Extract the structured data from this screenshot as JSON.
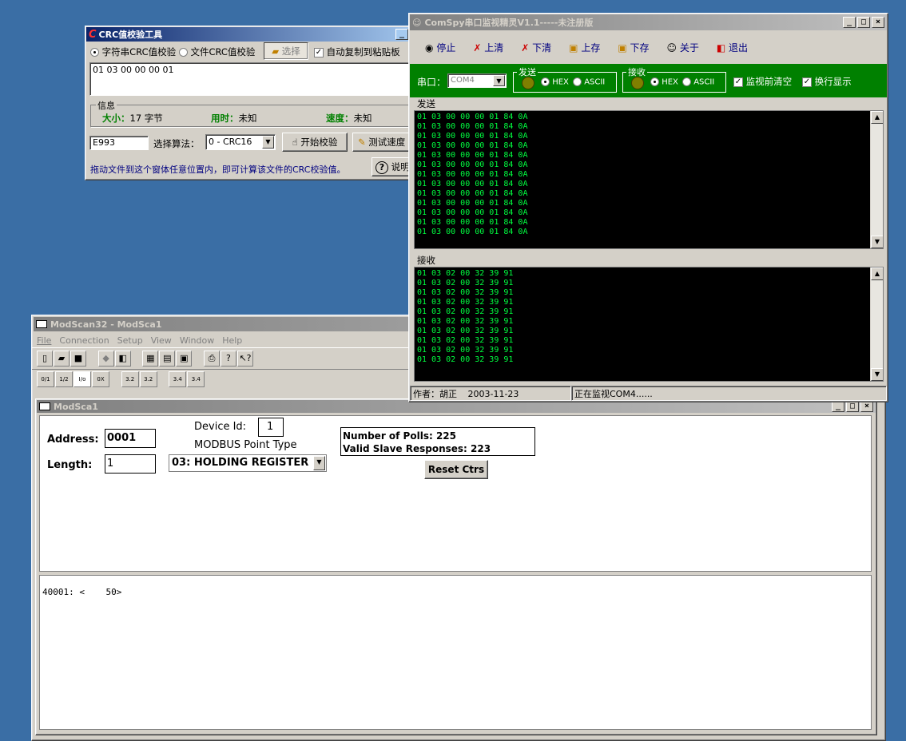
{
  "crc_window": {
    "title": "CRC值校验工具",
    "radio_string": "字符串CRC值校验",
    "radio_file": "文件CRC值校验",
    "select_button": "选择",
    "auto_copy": "自动复制到粘贴板",
    "input_text": "01 03 00 00 00 01",
    "info_group": "信息",
    "size_label": "大小：",
    "size_value": "17 字节",
    "time_label": "用时：",
    "time_value": "未知",
    "speed_label": "速度：",
    "speed_value": "未知",
    "crc_result": "E993",
    "algo_label": "选择算法：",
    "algo_value": "0 - CRC16",
    "start_button": "开始校验",
    "test_speed_button": "测试速度",
    "hint": "拖动文件到这个窗体任意位置内，即可计算该文件的CRC校验值。",
    "help_button": "说明"
  },
  "comspy": {
    "title": "ComSpy串口监视精灵V1.1-----未注册版",
    "toolbar": [
      "停止",
      "上清",
      "下清",
      "上存",
      "下存",
      "关于",
      "退出"
    ],
    "port_label": "串口：",
    "port_value": "COM4",
    "send_group": "发送",
    "recv_group": "接收",
    "hex": "HEX",
    "ascii": "ASCII",
    "clear_before": "监视前清空",
    "wrap_display": "换行显示",
    "send_panel": "发送",
    "recv_panel": "接收",
    "send_lines": [
      "01 03 00 00 00 01 84 0A",
      "01 03 00 00 00 01 84 0A",
      "01 03 00 00 00 01 84 0A",
      "01 03 00 00 00 01 84 0A",
      "01 03 00 00 00 01 84 0A",
      "01 03 00 00 00 01 84 0A",
      "01 03 00 00 00 01 84 0A",
      "01 03 00 00 00 01 84 0A",
      "01 03 00 00 00 01 84 0A",
      "01 03 00 00 00 01 84 0A",
      "01 03 00 00 00 01 84 0A",
      "01 03 00 00 00 01 84 0A",
      "01 03 00 00 00 01 84 0A"
    ],
    "recv_lines": [
      "01 03 02 00 32 39 91",
      "01 03 02 00 32 39 91",
      "01 03 02 00 32 39 91",
      "01 03 02 00 32 39 91",
      "01 03 02 00 32 39 91",
      "01 03 02 00 32 39 91",
      "01 03 02 00 32 39 91",
      "01 03 02 00 32 39 91",
      "01 03 02 00 32 39 91",
      "01 03 02 00 32 39 91"
    ],
    "status_author": "作者：胡正",
    "status_date": "2003-11-23",
    "status_monitor": "正在监视COM4......"
  },
  "modscan": {
    "title": "ModScan32 - ModSca1",
    "menu": [
      "File",
      "Connection",
      "Setup",
      "View",
      "Window",
      "Help"
    ],
    "child_title": "ModSca1",
    "device_id_label": "Device Id:",
    "device_id": "1",
    "address_label": "Address:",
    "address": "0001",
    "point_type_label": "MODBUS Point Type",
    "length_label": "Length:",
    "length": "1",
    "point_type": "03: HOLDING REGISTER",
    "polls": "Number of Polls: 225",
    "responses": "Valid Slave Responses: 223",
    "reset_button": "Reset Ctrs",
    "data_line": "40001: <    50>",
    "tb2_labels": [
      "0/1",
      "1/2",
      "I/o",
      "0X",
      "3.2",
      "3.2",
      "3.4",
      "3.4"
    ]
  }
}
